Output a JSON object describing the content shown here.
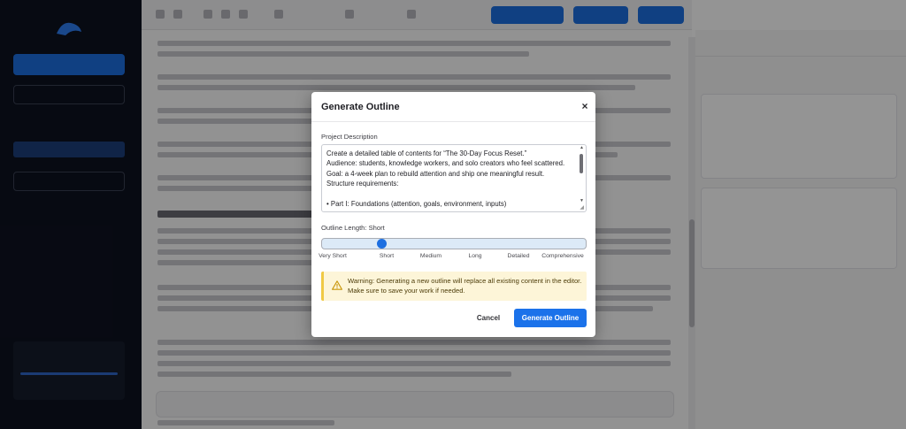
{
  "modal": {
    "title": "Generate Outline",
    "close_glyph": "×",
    "description_label": "Project Description",
    "description_value": "Create a detailed table of contents for “The 30-Day Focus Reset.”\nAudience: students, knowledge workers, and solo creators who feel scattered.\nGoal: a 4-week plan to rebuild attention and ship one meaningful result.\nStructure requirements:\n\n• Part I: Foundations (attention, goals, environment, inputs)",
    "length_label": "Outline Length: Short",
    "length_options": [
      "Very Short",
      "Short",
      "Medium",
      "Long",
      "Detailed",
      "Comprehensive"
    ],
    "selected_length_index": 1,
    "warning": "Warning: Generating a new outline will replace all existing content in the editor. Make sure to save your work if needed.",
    "cancel_label": "Cancel",
    "generate_label": "Generate Outline"
  },
  "colors": {
    "primary": "#1b72ea",
    "warning_bg": "#fdf5d8",
    "warning_accent": "#f0c945",
    "sidebar_bg": "#0d1220",
    "overlay": "rgba(0,0,0,0.42)"
  },
  "icons": {
    "close": "close-icon",
    "warning": "warning-icon"
  }
}
